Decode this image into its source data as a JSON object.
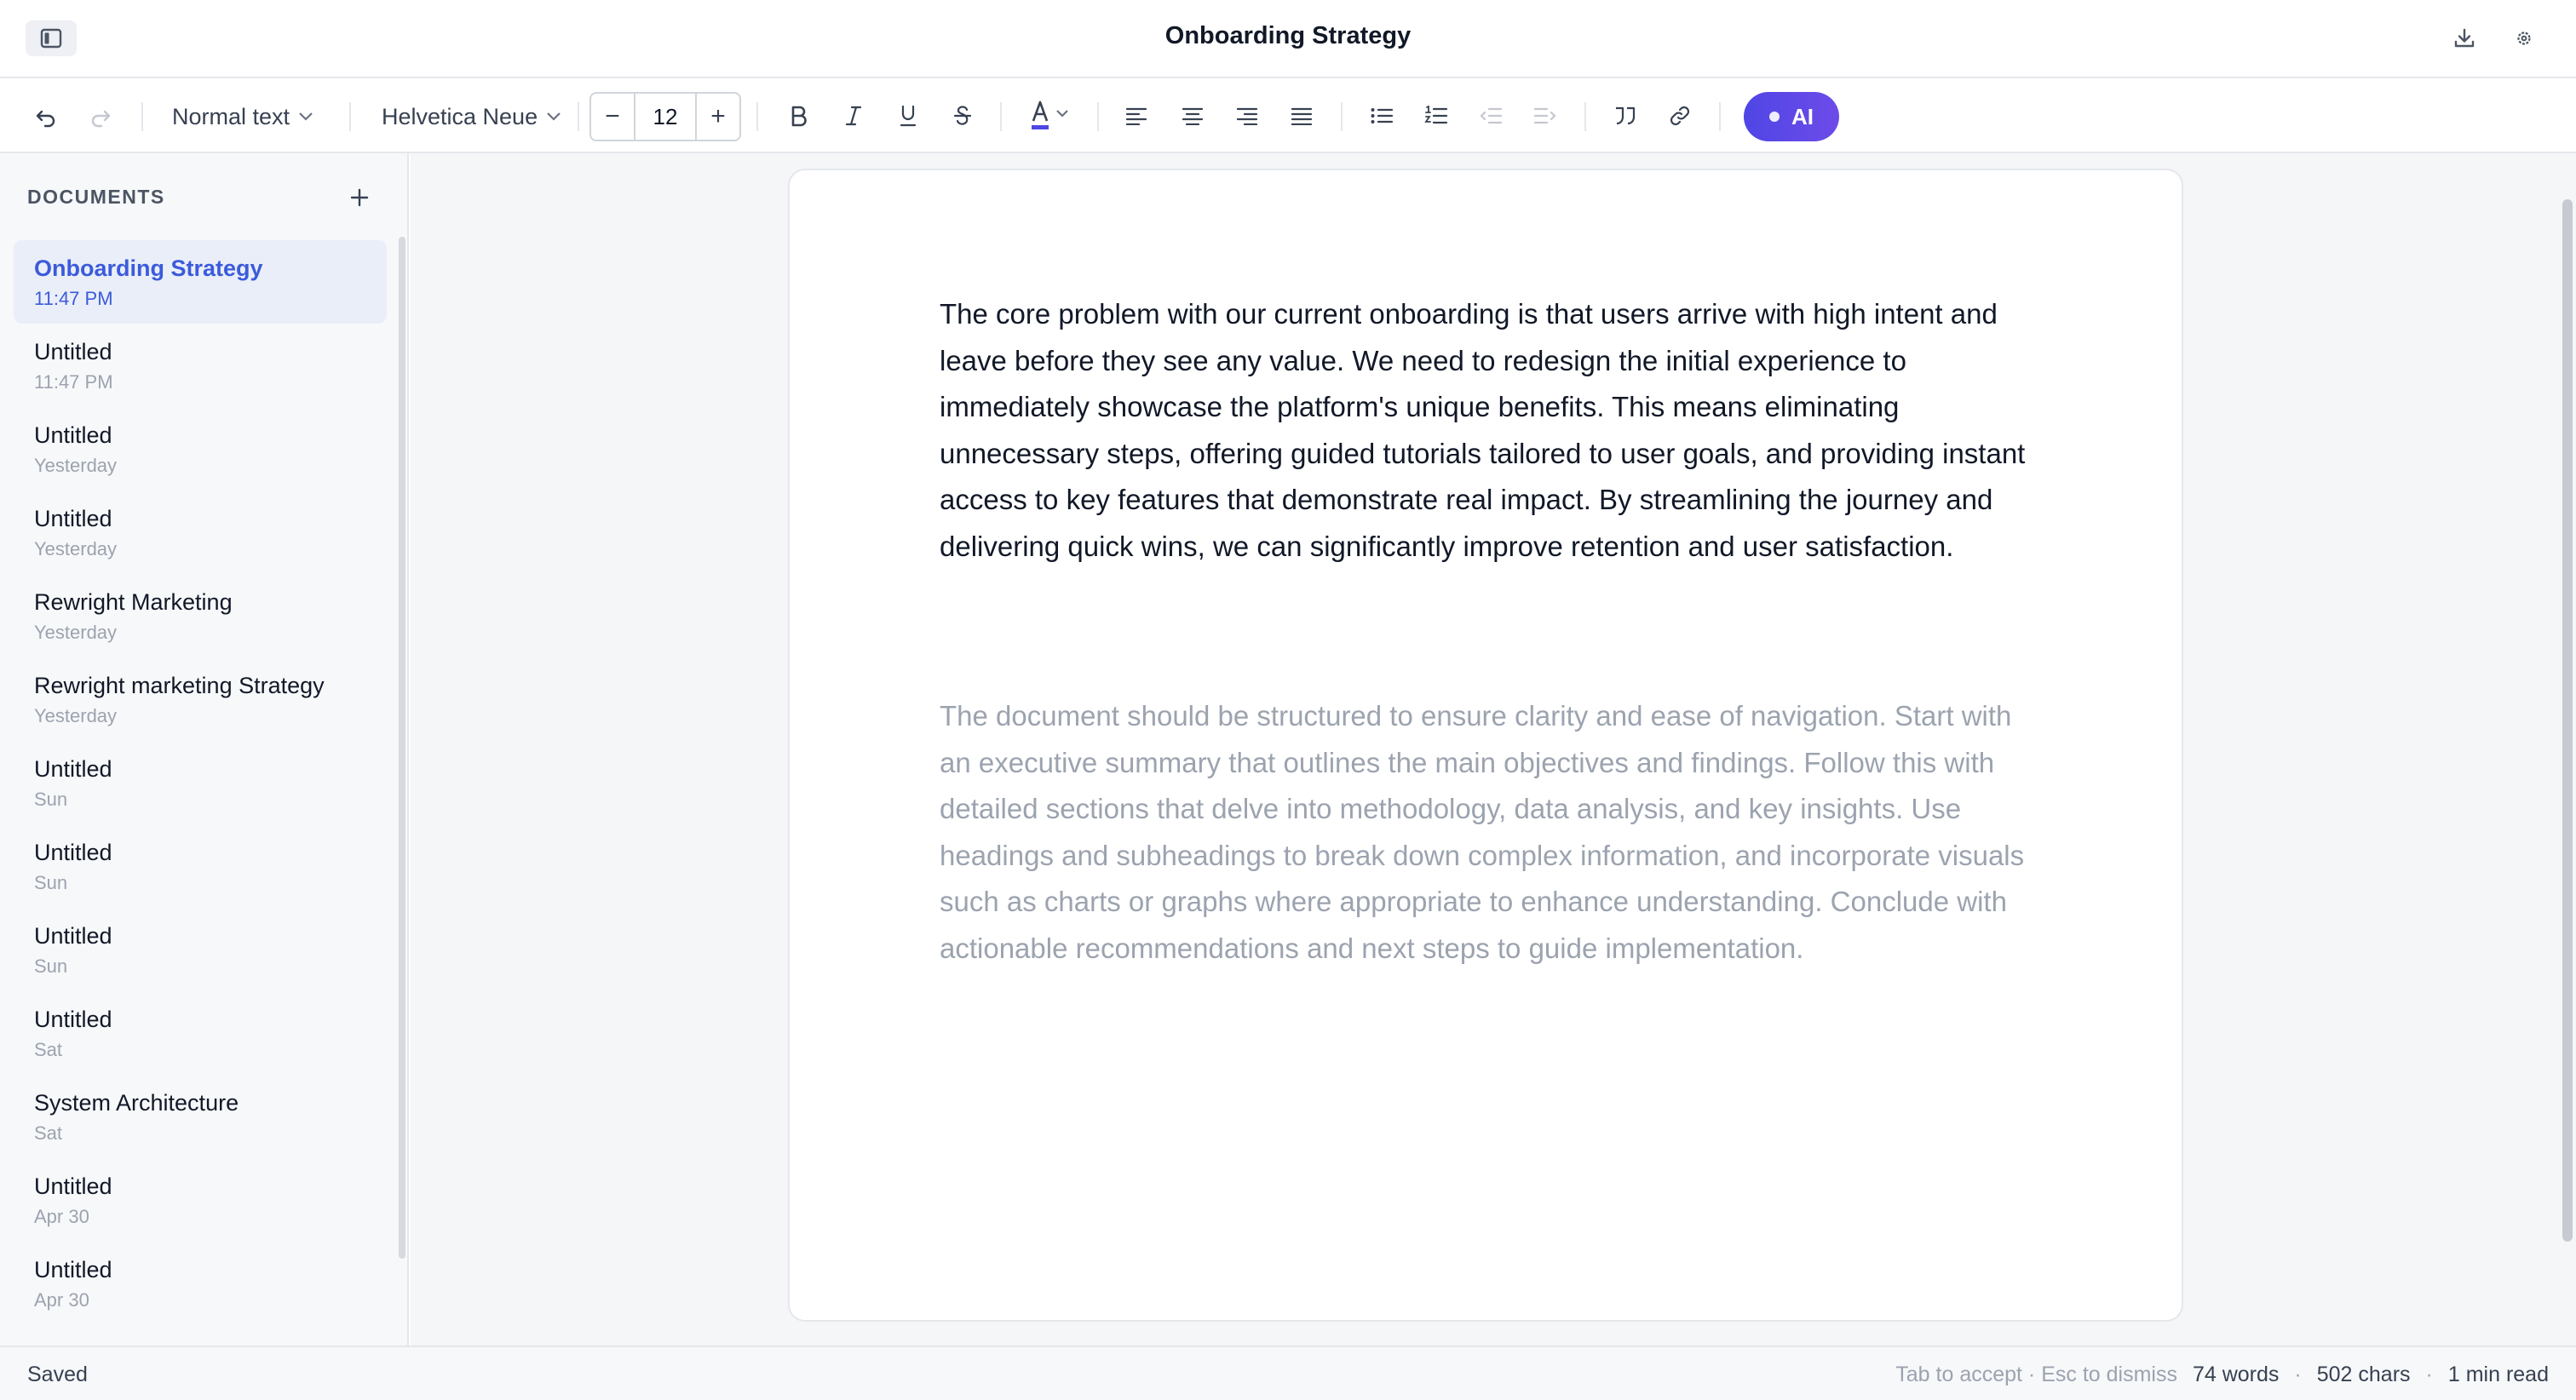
{
  "window": {
    "title": "Onboarding Strategy"
  },
  "toolbar": {
    "block_style": "Normal text",
    "font_family": "Helvetica Neue",
    "font_size": "12",
    "decrease_label": "−",
    "increase_label": "+",
    "ai_label": "AI",
    "ai_color": "#4f46e5"
  },
  "sidebar": {
    "header": "DOCUMENTS",
    "documents": [
      {
        "title": "Onboarding Strategy",
        "time": "11:47 PM"
      },
      {
        "title": "Untitled",
        "time": "11:47 PM"
      },
      {
        "title": "Untitled",
        "time": "Yesterday"
      },
      {
        "title": "Untitled",
        "time": "Yesterday"
      },
      {
        "title": "Rewright Marketing",
        "time": "Yesterday"
      },
      {
        "title": "Rewright marketing Strategy",
        "time": "Yesterday"
      },
      {
        "title": "Untitled",
        "time": "Sun"
      },
      {
        "title": "Untitled",
        "time": "Sun"
      },
      {
        "title": "Untitled",
        "time": "Sun"
      },
      {
        "title": "Untitled",
        "time": "Sat"
      },
      {
        "title": "System Architecture",
        "time": "Sat"
      },
      {
        "title": "Untitled",
        "time": "Apr 30"
      },
      {
        "title": "Untitled",
        "time": "Apr 30"
      }
    ]
  },
  "editor": {
    "paragraph": "The core problem with our current onboarding is that users arrive with high intent and leave before they see any value. We need to redesign the initial experience to immediately showcase the platform's unique benefits. This means eliminating unnecessary steps, offering guided tutorials tailored to user goals, and providing instant access to key features that demonstrate real impact. By streamlining the journey and delivering quick wins, we can significantly improve retention and user satisfaction.",
    "suggestion": "The document should be structured to ensure clarity and ease of navigation. Start with an executive summary that outlines the main objectives and findings. Follow this with detailed sections that delve into methodology, data analysis, and key insights. Use headings and subheadings to break down complex information, and incorporate visuals such as charts or graphs where appropriate to enhance understanding. Conclude with actionable recommendations and next steps to guide implementation."
  },
  "status": {
    "save_state": "Saved",
    "hint": "Tab to accept · Esc to dismiss",
    "words": "74 words",
    "chars": "502 chars",
    "read_time": "1 min read",
    "separator": "·"
  }
}
